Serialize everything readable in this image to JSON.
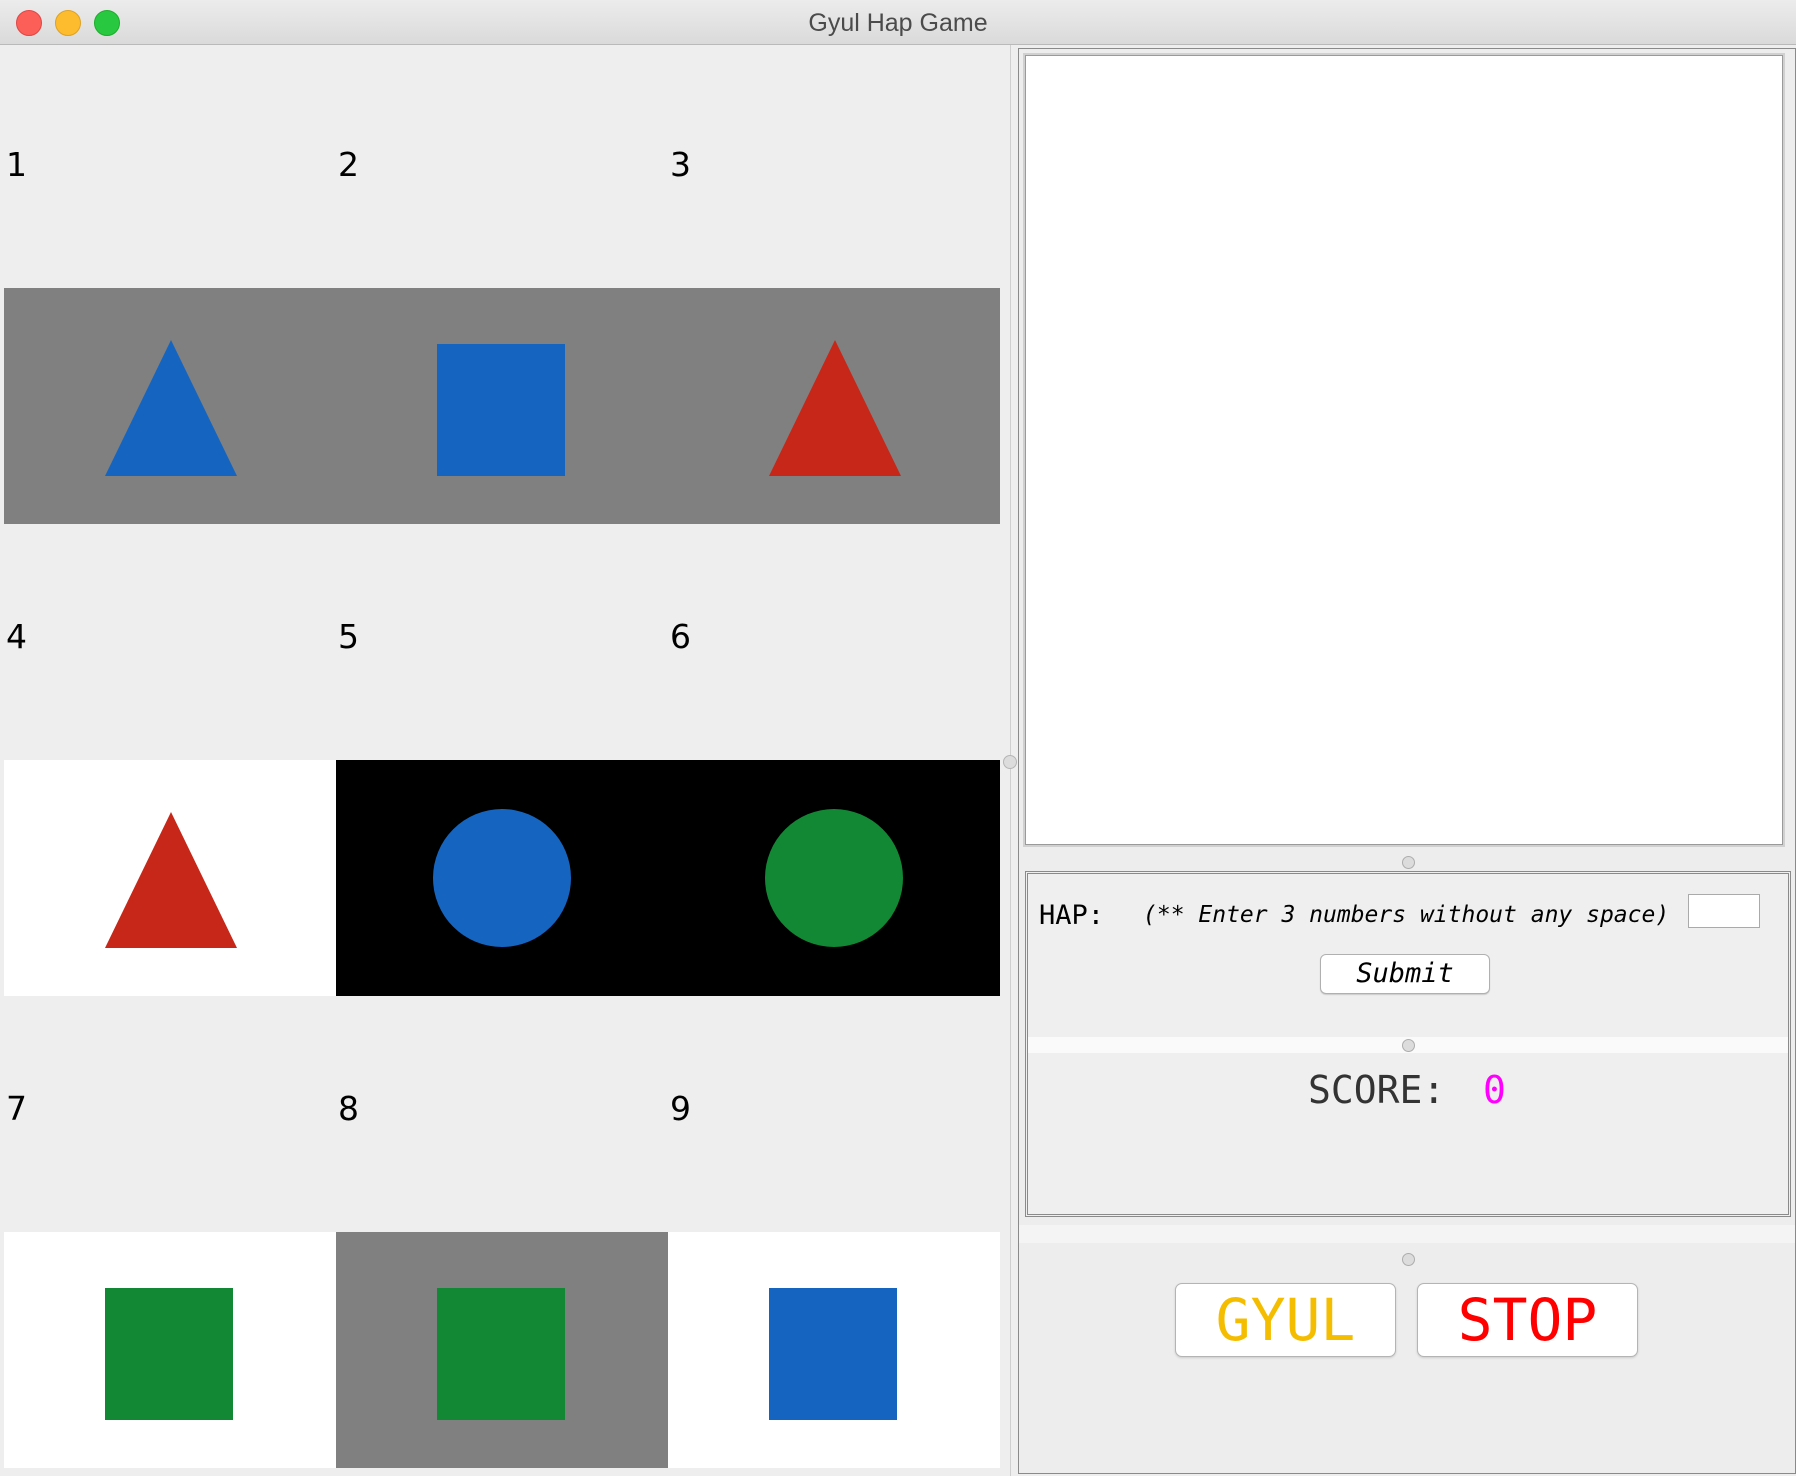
{
  "window": {
    "title": "Gyul Hap Game"
  },
  "grid": {
    "cells": [
      {
        "label": "1",
        "background": "#808080",
        "shape": "triangle",
        "color": "#1565c0"
      },
      {
        "label": "2",
        "background": "#808080",
        "shape": "square",
        "color": "#1565c0"
      },
      {
        "label": "3",
        "background": "#808080",
        "shape": "triangle",
        "color": "#c62718"
      },
      {
        "label": "4",
        "background": "#ffffff",
        "shape": "triangle",
        "color": "#c62718"
      },
      {
        "label": "5",
        "background": "#000000",
        "shape": "circle",
        "color": "#1565c0"
      },
      {
        "label": "6",
        "background": "#000000",
        "shape": "circle",
        "color": "#138834"
      },
      {
        "label": "7",
        "background": "#ffffff",
        "shape": "square",
        "color": "#138834"
      },
      {
        "label": "8",
        "background": "#808080",
        "shape": "square",
        "color": "#138834"
      },
      {
        "label": "9",
        "background": "#ffffff",
        "shape": "square",
        "color": "#1565c0"
      }
    ]
  },
  "hap": {
    "label": "HAP:",
    "hint": "(** Enter 3 numbers without any space)",
    "input_value": "",
    "submit_label": "Submit"
  },
  "score": {
    "label": "SCORE:",
    "value": "0",
    "value_color": "#ff00ff"
  },
  "buttons": {
    "gyul_label": "GYUL",
    "gyul_color": "#f5bd00",
    "stop_label": "STOP",
    "stop_color": "#ff0000"
  }
}
